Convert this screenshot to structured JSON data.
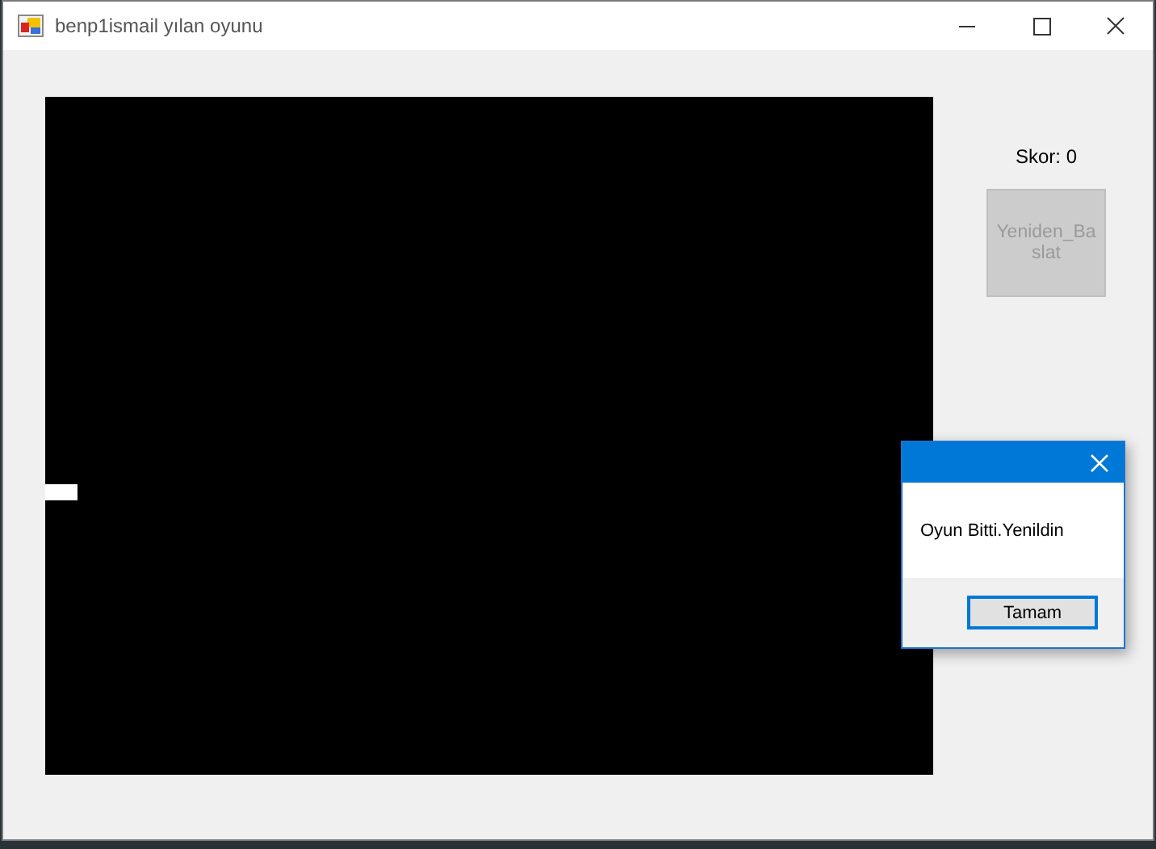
{
  "window": {
    "title": "benp1ismail yılan oyunu"
  },
  "score": {
    "text": "Skor: 0"
  },
  "restart_button": {
    "label": "Yeniden_Baslat",
    "disabled": true
  },
  "dialog": {
    "message": "Oyun Bitti.Yenildin",
    "button": "Tamam"
  }
}
